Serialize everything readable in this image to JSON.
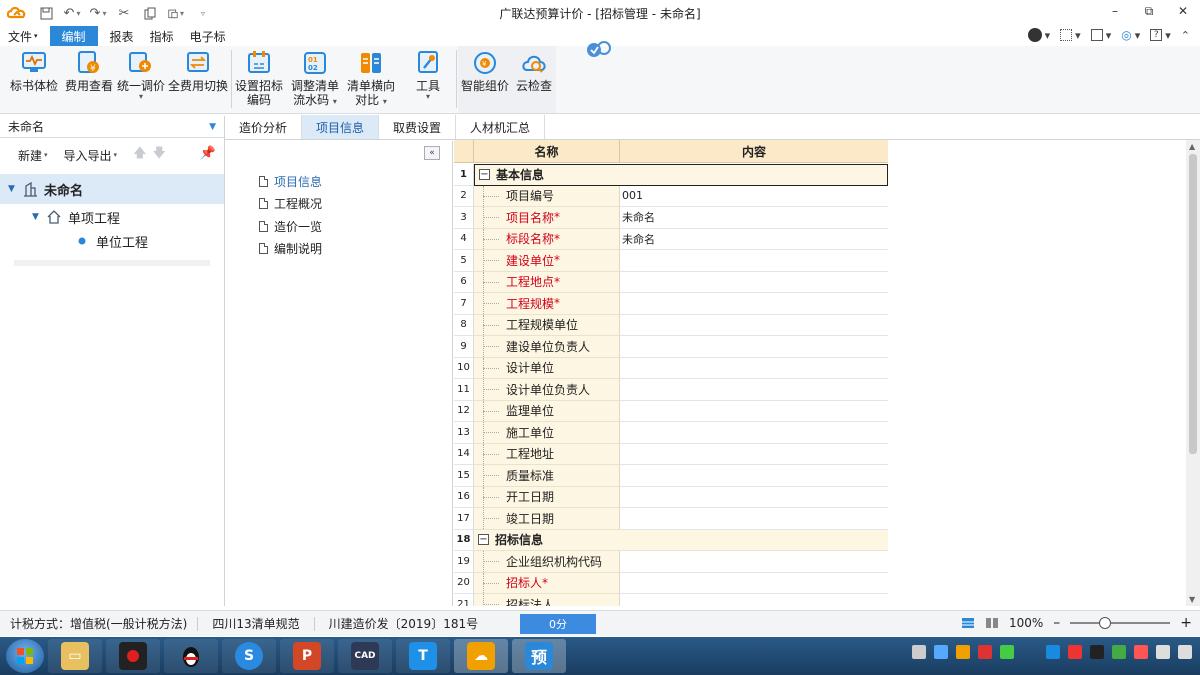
{
  "window": {
    "title": "广联达预算计价 - [招标管理 - 未命名]"
  },
  "menu": {
    "items": [
      "文件",
      "编制",
      "报表",
      "指标",
      "电子标"
    ],
    "active_index": 1
  },
  "ribbon": {
    "buttons": [
      {
        "label1": "标书体检",
        "label2": "",
        "icon": "monitor-check-icon"
      },
      {
        "label1": "费用查看",
        "label2": "",
        "icon": "cost-view-icon"
      },
      {
        "label1": "统一调价",
        "label2": "",
        "icon": "price-adjust-icon",
        "dropdown": true
      },
      {
        "label1": "全费用切换",
        "label2": "",
        "icon": "full-cost-switch-icon"
      },
      {
        "label1": "设置招标",
        "label2": "编码",
        "icon": "bid-code-icon"
      },
      {
        "label1": "调整清单",
        "label2": "流水码",
        "icon": "serial-code-icon",
        "dropdown": true
      },
      {
        "label1": "清单横向",
        "label2": "对比",
        "icon": "compare-icon",
        "dropdown": true
      },
      {
        "label1": "工具",
        "label2": "",
        "icon": "tools-icon",
        "dropdown": true
      },
      {
        "label1": "智能组价",
        "label2": "",
        "icon": "smart-price-icon"
      },
      {
        "label1": "云检查",
        "label2": "",
        "icon": "cloud-check-icon"
      }
    ]
  },
  "left": {
    "project_selector": "未命名",
    "toolbar": {
      "new_label": "新建",
      "import_export_label": "导入导出"
    },
    "tree": [
      {
        "label": "未命名",
        "level": 0,
        "bold": true,
        "selected": true,
        "icon": "building-icon",
        "expanded": true
      },
      {
        "label": "单项工程",
        "level": 1,
        "bold": false,
        "selected": false,
        "icon": "home-icon",
        "expanded": true
      },
      {
        "label": "单位工程",
        "level": 2,
        "bold": false,
        "selected": false,
        "icon": "dot-icon"
      }
    ]
  },
  "tabs": [
    "造价分析",
    "项目信息",
    "取费设置",
    "人材机汇总"
  ],
  "active_tab": 1,
  "nav": {
    "items": [
      "项目信息",
      "工程概况",
      "造价一览",
      "编制说明"
    ],
    "active_index": 0
  },
  "grid": {
    "headers": {
      "name": "名称",
      "content": "内容"
    },
    "rows": [
      {
        "num": "1",
        "name": "基本信息",
        "content": "",
        "group": true,
        "selected": true
      },
      {
        "num": "2",
        "name": "项目编号",
        "content": "001"
      },
      {
        "num": "3",
        "name": "项目名称",
        "req": "*",
        "content": "未命名"
      },
      {
        "num": "4",
        "name": "标段名称",
        "req": "*",
        "content": "未命名"
      },
      {
        "num": "5",
        "name": "建设单位",
        "req": "*",
        "content": ""
      },
      {
        "num": "6",
        "name": "工程地点",
        "req": "*",
        "content": ""
      },
      {
        "num": "7",
        "name": "工程规模",
        "req": "*",
        "content": ""
      },
      {
        "num": "8",
        "name": "工程规模单位",
        "content": ""
      },
      {
        "num": "9",
        "name": "建设单位负责人",
        "content": ""
      },
      {
        "num": "10",
        "name": "设计单位",
        "content": ""
      },
      {
        "num": "11",
        "name": "设计单位负责人",
        "content": ""
      },
      {
        "num": "12",
        "name": "监理单位",
        "content": ""
      },
      {
        "num": "13",
        "name": "施工单位",
        "content": ""
      },
      {
        "num": "14",
        "name": "工程地址",
        "content": ""
      },
      {
        "num": "15",
        "name": "质量标准",
        "content": ""
      },
      {
        "num": "16",
        "name": "开工日期",
        "content": ""
      },
      {
        "num": "17",
        "name": "竣工日期",
        "content": ""
      },
      {
        "num": "18",
        "name": "招标信息",
        "content": "",
        "group": true
      },
      {
        "num": "19",
        "name": "企业组织机构代码",
        "content": ""
      },
      {
        "num": "20",
        "name": "招标人",
        "req": "*",
        "content": ""
      },
      {
        "num": "21",
        "name": "招标法人",
        "content": ""
      }
    ]
  },
  "status": {
    "tax_method": "计税方式：增值税(一般计税方法)",
    "standard": "四川13清单规范",
    "doc": "川建造价发〔2019〕181号",
    "score": "0分",
    "zoom": "100%",
    "zoom_level": 0.35
  },
  "colors": {
    "accent": "#2b87d8",
    "header_bg": "#fbe9c8",
    "name_col_bg": "#fdf6e3",
    "required_red": "#d0021b",
    "selection": "#dce9f7"
  }
}
